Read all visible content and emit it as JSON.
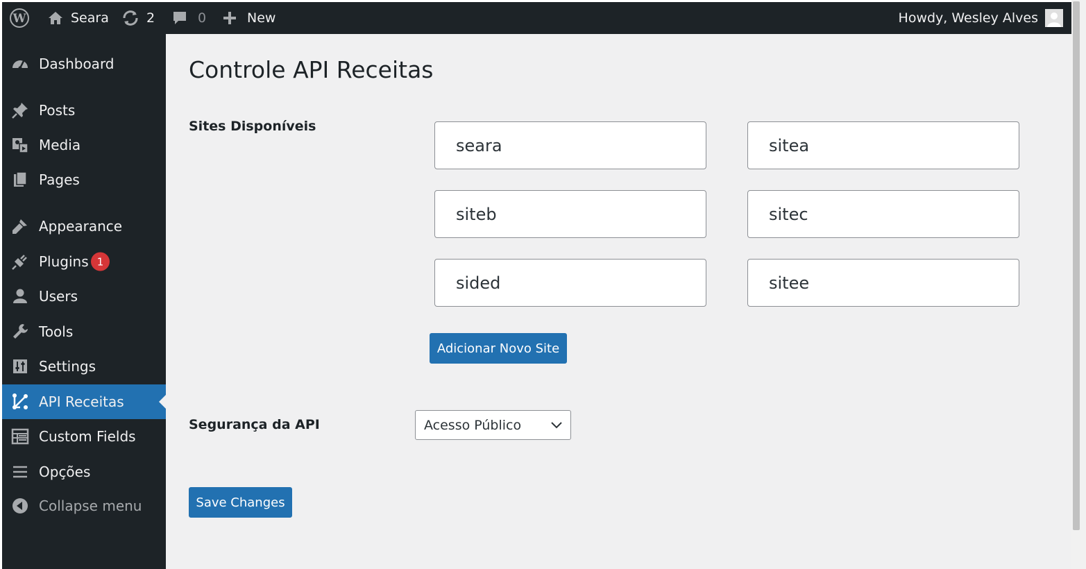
{
  "adminbar": {
    "site_name": "Seara",
    "updates_count": "2",
    "comments_count": "0",
    "new_label": "New",
    "howdy": "Howdy, Wesley Alves"
  },
  "sidebar": {
    "items": [
      {
        "label": "Dashboard",
        "icon": "dashboard-icon"
      },
      {
        "label": "Posts",
        "icon": "pin-icon"
      },
      {
        "label": "Media",
        "icon": "media-icon"
      },
      {
        "label": "Pages",
        "icon": "pages-icon"
      },
      {
        "label": "Appearance",
        "icon": "paintbrush-icon"
      },
      {
        "label": "Plugins",
        "icon": "plug-icon",
        "badge": "1"
      },
      {
        "label": "Users",
        "icon": "user-icon"
      },
      {
        "label": "Tools",
        "icon": "wrench-icon"
      },
      {
        "label": "Settings",
        "icon": "settings-icon"
      },
      {
        "label": "API Receitas",
        "icon": "network-icon",
        "current": true
      },
      {
        "label": "Custom Fields",
        "icon": "table-icon"
      },
      {
        "label": "Opções",
        "icon": "menu-icon"
      }
    ],
    "collapse_label": "Collapse menu"
  },
  "main": {
    "title": "Controle API Receitas",
    "sites_label": "Sites Disponíveis",
    "sites": [
      "seara",
      "sitea",
      "siteb",
      "sitec",
      "sided",
      "sitee"
    ],
    "add_site_label": "Adicionar Novo Site",
    "security_label": "Segurança da API",
    "security_selected": "Acesso Público",
    "save_label": "Save Changes"
  },
  "colors": {
    "adminbar_bg": "#1d2327",
    "accent": "#2271b1",
    "badge": "#d63638",
    "content_bg": "#f0f0f1"
  }
}
